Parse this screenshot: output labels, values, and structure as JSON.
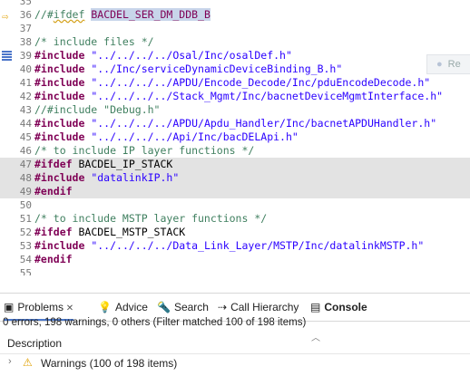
{
  "editor": {
    "lines": [
      {
        "n": "35",
        "segs": []
      },
      {
        "n": "36",
        "segs": [
          {
            "c": "cm",
            "t": "//#"
          },
          {
            "c": "cm squig",
            "t": "ifdef"
          },
          {
            "c": "cm",
            "t": " "
          },
          {
            "c": "cm sel",
            "t": "BACDEL_SER_DM_DDB_B"
          }
        ]
      },
      {
        "n": "37",
        "segs": []
      },
      {
        "n": "38",
        "segs": [
          {
            "c": "cm",
            "t": "/* include files */"
          }
        ]
      },
      {
        "n": "39",
        "segs": [
          {
            "c": "kw",
            "t": "#include"
          },
          {
            "c": "",
            "t": " "
          },
          {
            "c": "str",
            "t": "\"../../../../Osal/Inc/osalDef.h\""
          }
        ]
      },
      {
        "n": "40",
        "segs": [
          {
            "c": "kw",
            "t": "#include"
          },
          {
            "c": "",
            "t": " "
          },
          {
            "c": "str",
            "t": "\"../Inc/serviceDynamicDeviceBinding_B.h\""
          }
        ]
      },
      {
        "n": "41",
        "segs": [
          {
            "c": "kw",
            "t": "#include"
          },
          {
            "c": "",
            "t": " "
          },
          {
            "c": "str",
            "t": "\"../../../../APDU/Encode_Decode/Inc/pduEncodeDecode.h\""
          }
        ]
      },
      {
        "n": "42",
        "segs": [
          {
            "c": "kw",
            "t": "#include"
          },
          {
            "c": "",
            "t": " "
          },
          {
            "c": "str",
            "t": "\"../../../../Stack_Mgmt/Inc/bacnetDeviceMgmtInterface.h\""
          }
        ]
      },
      {
        "n": "43",
        "segs": [
          {
            "c": "cm",
            "t": "//#include \"Debug.h\""
          }
        ]
      },
      {
        "n": "44",
        "segs": [
          {
            "c": "kw",
            "t": "#include"
          },
          {
            "c": "",
            "t": " "
          },
          {
            "c": "str",
            "t": "\"../../../../APDU/Apdu_Handler/Inc/bacnetAPDUHandler.h\""
          }
        ]
      },
      {
        "n": "45",
        "segs": [
          {
            "c": "kw",
            "t": "#include"
          },
          {
            "c": "",
            "t": " "
          },
          {
            "c": "str",
            "t": "\"../../../../Api/Inc/bacDELApi.h\""
          }
        ]
      },
      {
        "n": "46",
        "segs": [
          {
            "c": "cm",
            "t": "/* to include IP layer functions */"
          }
        ]
      },
      {
        "n": "47",
        "hl": true,
        "segs": [
          {
            "c": "kw",
            "t": "#ifdef"
          },
          {
            "c": "",
            "t": " BACDEL_IP_STACK"
          }
        ]
      },
      {
        "n": "48",
        "hl": true,
        "segs": [
          {
            "c": "kw",
            "t": "#include"
          },
          {
            "c": "",
            "t": " "
          },
          {
            "c": "str",
            "t": "\"datalinkIP.h\""
          }
        ]
      },
      {
        "n": "49",
        "hl": true,
        "segs": [
          {
            "c": "kw",
            "t": "#endif"
          }
        ]
      },
      {
        "n": "50",
        "segs": []
      },
      {
        "n": "51",
        "segs": [
          {
            "c": "cm",
            "t": "/* to include MSTP layer functions */"
          }
        ]
      },
      {
        "n": "52",
        "segs": [
          {
            "c": "kw",
            "t": "#ifdef"
          },
          {
            "c": "",
            "t": " BACDEL_MSTP_STACK"
          }
        ]
      },
      {
        "n": "53",
        "segs": [
          {
            "c": "kw",
            "t": "#include"
          },
          {
            "c": "",
            "t": " "
          },
          {
            "c": "str",
            "t": "\"../../../../Data_Link_Layer/MSTP/Inc/datalinkMSTP.h\""
          }
        ]
      },
      {
        "n": "54",
        "segs": [
          {
            "c": "kw",
            "t": "#endif"
          }
        ]
      },
      {
        "n": "55",
        "segs": []
      }
    ],
    "tooltip_text": "Re"
  },
  "tabs": [
    {
      "icon": "problems-icon",
      "glyph": "▣",
      "label": "Problems",
      "close": "✕",
      "active": true
    },
    {
      "icon": "advice-icon",
      "glyph": "💡",
      "label": "Advice"
    },
    {
      "icon": "search-icon",
      "glyph": "🔦",
      "label": "Search"
    },
    {
      "icon": "call-hierarchy-icon",
      "glyph": "⇢",
      "label": "Call Hierarchy"
    },
    {
      "icon": "console-icon",
      "glyph": "▤",
      "label": "Console",
      "bold": true
    }
  ],
  "problems": {
    "status": "0 errors, 198 warnings, 0 others (Filter matched 100 of 198 items)",
    "column": "Description",
    "rows": [
      {
        "label": "Warnings (100 of 198 items)"
      }
    ]
  },
  "colors": {
    "keyword": "#7f0055",
    "string": "#2a00ff",
    "comment": "#3f7f5f",
    "highlight": "#e3e3e3",
    "selection": "#c8d5ea"
  }
}
